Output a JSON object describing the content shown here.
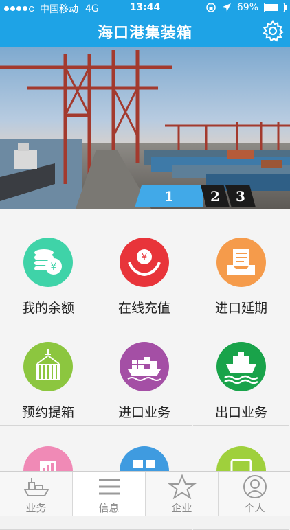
{
  "status_bar": {
    "carrier": "中国移动",
    "network": "4G",
    "time": "13:44",
    "battery": "69%"
  },
  "nav": {
    "title": "海口港集装箱"
  },
  "banner": {
    "pages": [
      "1",
      "2",
      "3"
    ],
    "active_page": 1
  },
  "grid": {
    "items": [
      {
        "label": "我的余额",
        "color": "#3fd3a8"
      },
      {
        "label": "在线充值",
        "color": "#e8343a"
      },
      {
        "label": "进口延期",
        "color": "#f59b4b"
      },
      {
        "label": "预约提箱",
        "color": "#8cc63f"
      },
      {
        "label": "进口业务",
        "color": "#a44fa5"
      },
      {
        "label": "出口业务",
        "color": "#19a34a"
      },
      {
        "label": "",
        "color": "#f08ab6"
      },
      {
        "label": "",
        "color": "#3f9be0"
      },
      {
        "label": "",
        "color": "#9fd03c"
      }
    ]
  },
  "tabbar": {
    "tabs": [
      {
        "label": "业务",
        "icon": "ship-icon"
      },
      {
        "label": "信息",
        "icon": "menu-icon"
      },
      {
        "label": "企业",
        "icon": "star-icon"
      },
      {
        "label": "个人",
        "icon": "user-icon"
      }
    ]
  },
  "colors": {
    "primary": "#1ea3e6"
  }
}
